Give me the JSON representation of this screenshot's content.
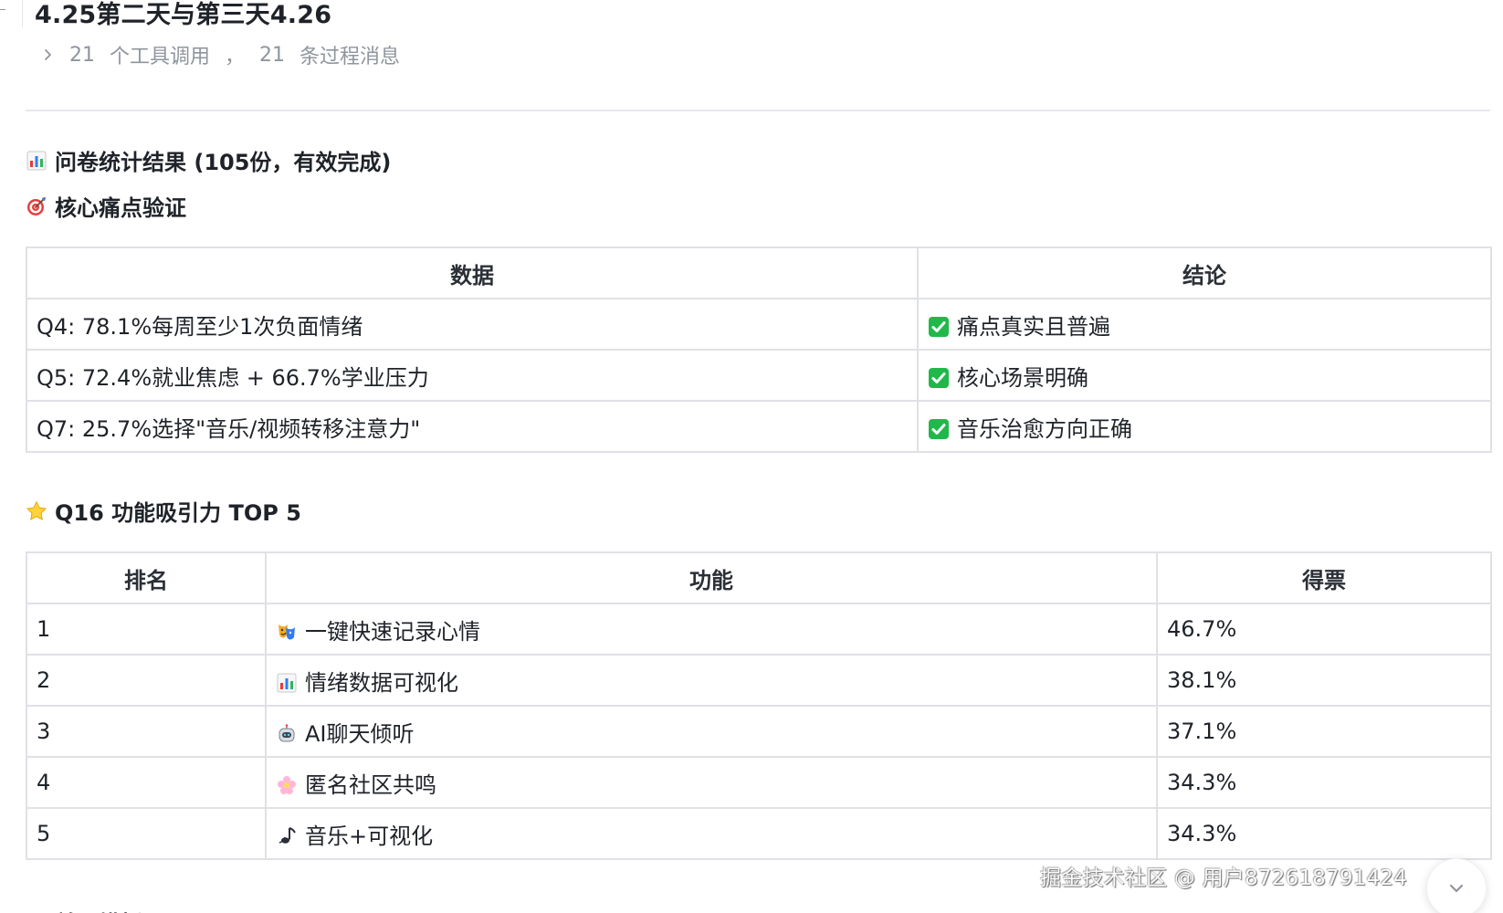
{
  "document": {
    "title": "4.25第二天与第三天4.26",
    "tool_summary": {
      "tool_count": "21",
      "tool_label": "个工具调用",
      "separator": "，",
      "message_count": "21",
      "message_label": "条过程消息"
    }
  },
  "sections": {
    "survey_heading": "问卷统计结果 (105份，有效完成)",
    "core_heading": "核心痛点验证",
    "top5_heading": "Q16 功能吸引力 TOP 5",
    "next_heading_partial": "首页模板"
  },
  "core_table": {
    "headers": [
      "数据",
      "结论"
    ],
    "rows": [
      {
        "label": "Q4",
        "data": ": 78.1%每周至少1次负面情绪",
        "conclusion": "痛点真实且普遍"
      },
      {
        "label": "Q5",
        "data": ": 72.4%就业焦虑 + 66.7%学业压力",
        "conclusion": "核心场景明确"
      },
      {
        "label": "Q7",
        "data": ": 25.7%选择\"音乐/视频转移注意力\"",
        "conclusion": "音乐治愈方向正确"
      }
    ]
  },
  "top5_table": {
    "headers": [
      "排名",
      "功能",
      "得票"
    ],
    "rows": [
      {
        "rank": "1",
        "icon": "mask-icon",
        "feature": "一键快速记录心情",
        "votes": "46.7%"
      },
      {
        "rank": "2",
        "icon": "bar-chart-icon",
        "feature": "情绪数据可视化",
        "votes": "38.1%"
      },
      {
        "rank": "3",
        "icon": "robot-icon",
        "feature": "AI聊天倾听",
        "votes": "37.1%"
      },
      {
        "rank": "4",
        "icon": "flower-icon",
        "feature": "匿名社区共鸣",
        "votes": "34.3%"
      },
      {
        "rank": "5",
        "icon": "music-note-icon",
        "feature": "音乐+可视化",
        "votes": "34.3%"
      }
    ]
  },
  "watermark": "掘金技术社区 @ 用户872618791424",
  "colors": {
    "text": "#1f2329",
    "muted": "#8f959e",
    "border": "#dfe1e5",
    "check": "#20b84a"
  }
}
